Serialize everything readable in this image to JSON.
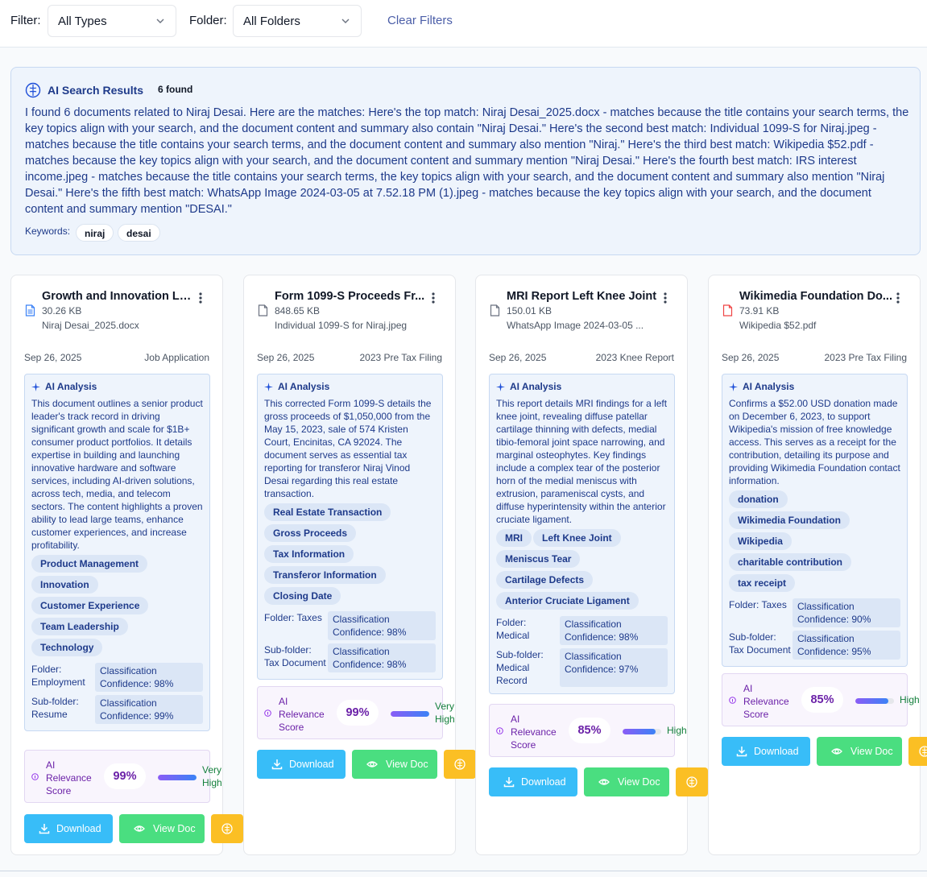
{
  "filters": {
    "filter_label": "Filter:",
    "type_value": "All Types",
    "folder_label": "Folder:",
    "folder_value": "All Folders",
    "clear_label": "Clear Filters"
  },
  "ai_results": {
    "title": "AI Search Results",
    "count": "6 found",
    "summary": "I found 6 documents related to Niraj Desai. Here are the matches: Here's the top match: Niraj Desai_2025.docx - matches because the title contains your search terms, the key topics align with your search, and the document content and summary also contain \"Niraj Desai.\" Here's the second best match: Individual 1099-S for Niraj.jpeg - matches because the title contains your search terms, and the document content and summary also mention \"Niraj.\" Here's the third best match: Wikipedia $52.pdf - matches because the key topics align with your search, and the document content and summary mention \"Niraj Desai.\" Here's the fourth best match: IRS interest income.jpeg - matches because the title contains your search terms, the key topics align with your search, and the document content and summary also mention \"Niraj Desai.\" Here's the fifth best match: WhatsApp Image 2024-03-05 at 7.52.18 PM (1).jpeg - matches because the key topics align with your search, and the document content and summary mention \"DESAI.\"",
    "keywords_label": "Keywords:",
    "keywords": [
      "niraj",
      "desai"
    ]
  },
  "labels": {
    "ai_analysis": "AI Analysis",
    "folder": "Folder:",
    "subfolder": "Sub-folder:",
    "relevance": "AI Relevance Score",
    "download": "Download",
    "view_doc": "View Doc"
  },
  "colors": {
    "doc_icon_blue": "#3b82f6",
    "doc_icon_gray": "#6b7280",
    "doc_icon_red": "#ef4444"
  },
  "cards": [
    {
      "title": "Growth and Innovation Le...",
      "size": "30.26 KB",
      "filename": "Niraj Desai_2025.docx",
      "date": "Sep 26, 2025",
      "category": "Job Application",
      "icon": "word-doc-icon",
      "summary": "This document outlines a senior product leader's track record in driving significant growth and scale for $1B+ consumer product portfolios. It details expertise in building and launching innovative hardware and software services, including AI-driven solutions, across tech, media, and telecom sectors. The content highlights a proven ability to lead large teams, enhance customer experiences, and increase profitability.",
      "tags": [
        "Product Management",
        "Innovation",
        "Customer Experience",
        "Team Leadership",
        "Technology"
      ],
      "folder_label": "Folder: Employment",
      "folder_conf": "Classification Confidence: 98%",
      "subfolder_label": "Sub-folder: Resume",
      "subfolder_conf": "Classification Confidence: 99%",
      "relevance": "99%",
      "relevance_fraction": 0.99,
      "relevance_quality": "Very High"
    },
    {
      "title": "Form 1099-S Proceeds Fr...",
      "size": "848.65 KB",
      "filename": "Individual 1099-S for Niraj.jpeg",
      "date": "Sep 26, 2025",
      "category": "2023 Pre Tax Filing",
      "icon": "file-icon",
      "summary": "This corrected Form 1099-S details the gross proceeds of $1,050,000 from the May 15, 2023, sale of 574 Kristen Court, Encinitas, CA 92024. The document serves as essential tax reporting for transferor Niraj Vinod Desai regarding this real estate transaction.",
      "tags": [
        "Real Estate Transaction",
        "Gross Proceeds",
        "Tax Information",
        "Transferor Information",
        "Closing Date"
      ],
      "folder_label": "Folder: Taxes",
      "folder_conf": "Classification Confidence: 98%",
      "subfolder_label": "Sub-folder: Tax Document",
      "subfolder_conf": "Classification Confidence: 98%",
      "relevance": "99%",
      "relevance_fraction": 0.99,
      "relevance_quality": "Very High"
    },
    {
      "title": "MRI Report Left Knee Joint",
      "size": "150.01 KB",
      "filename": "WhatsApp Image 2024-03-05 ...",
      "date": "Sep 26, 2025",
      "category": "2023 Knee Report",
      "icon": "file-icon",
      "summary": "This report details MRI findings for a left knee joint, revealing diffuse patellar cartilage thinning with defects, medial tibio-femoral joint space narrowing, and marginal osteophytes. Key findings include a complex tear of the posterior horn of the medial meniscus with extrusion, parameniscal cysts, and diffuse hyperintensity within the anterior cruciate ligament.",
      "tags": [
        "MRI",
        "Left Knee Joint",
        "Meniscus Tear",
        "Cartilage Defects",
        "Anterior Cruciate Ligament"
      ],
      "folder_label": "Folder: Medical",
      "folder_conf": "Classification Confidence: 98%",
      "subfolder_label": "Sub-folder: Medical Record",
      "subfolder_conf": "Classification Confidence: 97%",
      "relevance": "85%",
      "relevance_fraction": 0.85,
      "relevance_quality": "High"
    },
    {
      "title": "Wikimedia Foundation Do...",
      "size": "73.91 KB",
      "filename": "Wikipedia $52.pdf",
      "date": "Sep 26, 2025",
      "category": "2023 Pre Tax Filing",
      "icon": "pdf-icon",
      "summary": "Confirms a $52.00 USD donation made on December 6, 2023, to support Wikipedia's mission of free knowledge access. This serves as a receipt for the contribution, detailing its purpose and providing Wikimedia Foundation contact information.",
      "tags": [
        "donation",
        "Wikimedia Foundation",
        "Wikipedia",
        "charitable contribution",
        "tax receipt"
      ],
      "folder_label": "Folder: Taxes",
      "folder_conf": "Classification Confidence: 90%",
      "subfolder_label": "Sub-folder: Tax Document",
      "subfolder_conf": "Classification Confidence: 95%",
      "relevance": "85%",
      "relevance_fraction": 0.85,
      "relevance_quality": "High"
    }
  ]
}
